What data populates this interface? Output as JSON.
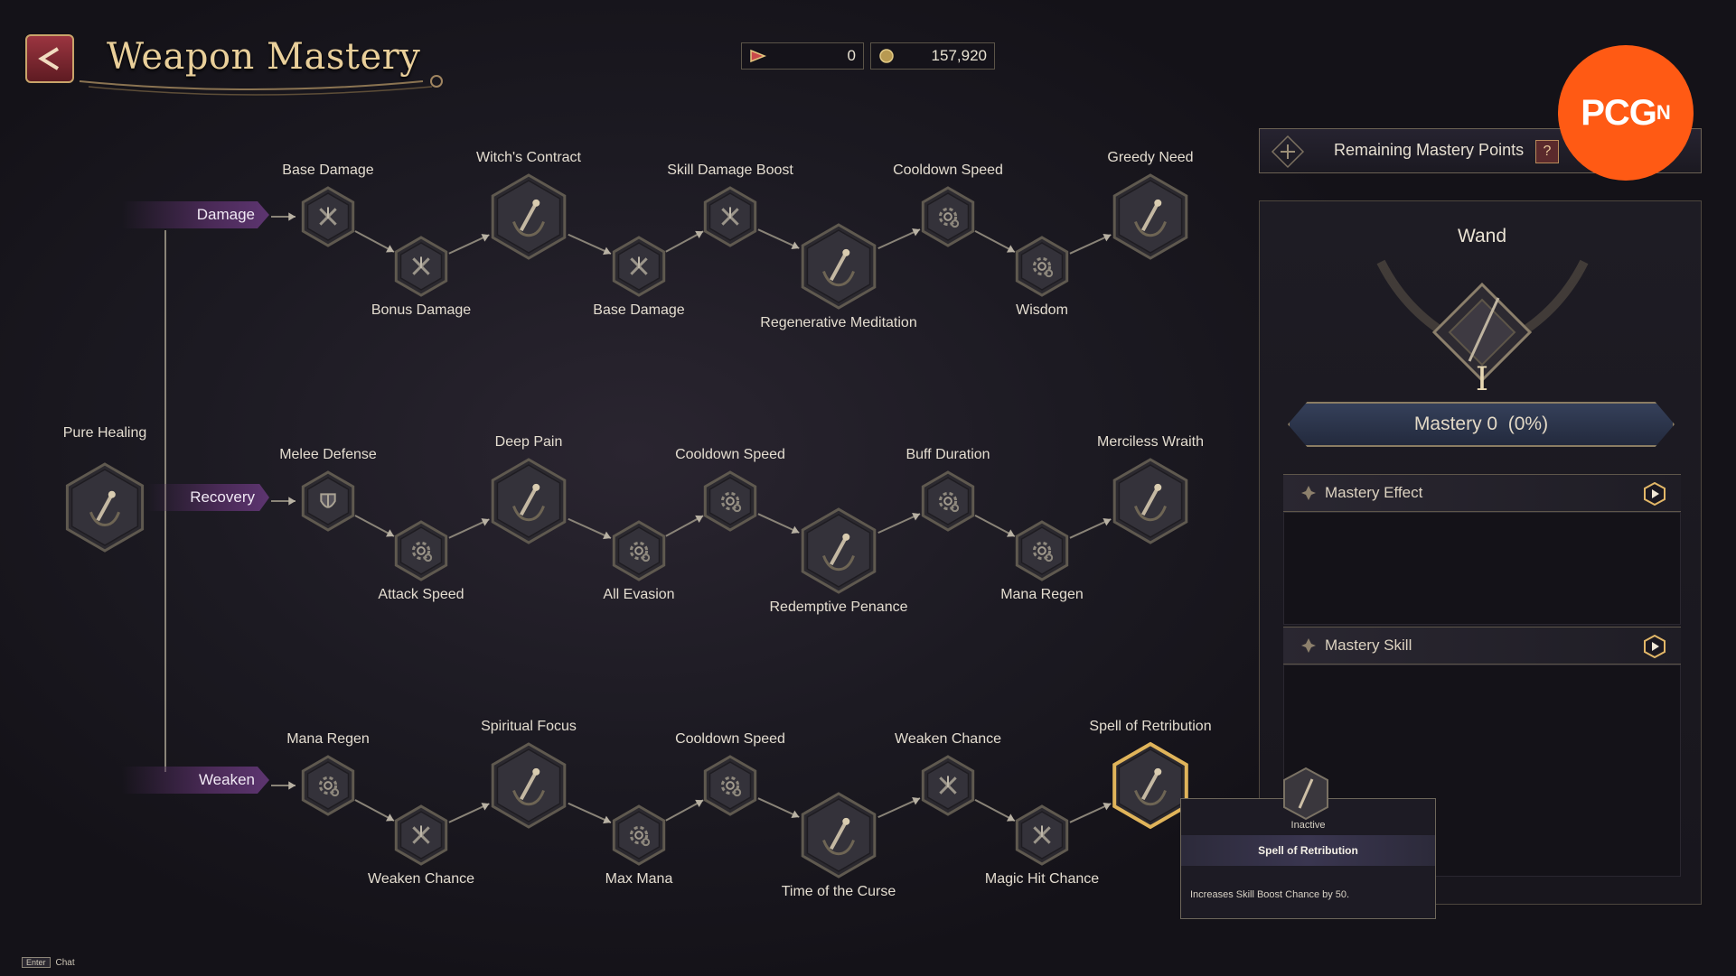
{
  "header": {
    "title": "Weapon Mastery",
    "currency_a": "0",
    "currency_b": "157,920"
  },
  "root_node": {
    "label": "Pure Healing"
  },
  "branches": [
    {
      "name": "Damage",
      "nodes": [
        {
          "label": "Base Damage",
          "type": "small",
          "icon": "crossed-swords-icon"
        },
        {
          "label": "Bonus Damage",
          "type": "small",
          "icon": "crossed-swords-icon"
        },
        {
          "label": "Witch's Contract",
          "type": "large",
          "icon": "wand-icon"
        },
        {
          "label": "Base Damage",
          "type": "small",
          "icon": "crossed-swords-icon"
        },
        {
          "label": "Skill Damage Boost",
          "type": "small",
          "icon": "crossed-swords-icon"
        },
        {
          "label": "Regenerative Meditation",
          "type": "large",
          "icon": "wand-icon"
        },
        {
          "label": "Cooldown Speed",
          "type": "small",
          "icon": "gear-icon"
        },
        {
          "label": "Wisdom",
          "type": "small",
          "icon": "gear-icon"
        },
        {
          "label": "Greedy Need",
          "type": "large",
          "icon": "wand-icon"
        }
      ]
    },
    {
      "name": "Recovery",
      "nodes": [
        {
          "label": "Melee Defense",
          "type": "small",
          "icon": "shield-icon"
        },
        {
          "label": "Attack Speed",
          "type": "small",
          "icon": "gear-icon"
        },
        {
          "label": "Deep Pain",
          "type": "large",
          "icon": "wand-icon"
        },
        {
          "label": "All Evasion",
          "type": "small",
          "icon": "gear-icon"
        },
        {
          "label": "Cooldown Speed",
          "type": "small",
          "icon": "gear-icon"
        },
        {
          "label": "Redemptive Penance",
          "type": "large",
          "icon": "wand-icon"
        },
        {
          "label": "Buff Duration",
          "type": "small",
          "icon": "gear-icon"
        },
        {
          "label": "Mana Regen",
          "type": "small",
          "icon": "gear-icon"
        },
        {
          "label": "Merciless Wraith",
          "type": "large",
          "icon": "wand-icon"
        }
      ]
    },
    {
      "name": "Weaken",
      "nodes": [
        {
          "label": "Mana Regen",
          "type": "small",
          "icon": "gear-icon"
        },
        {
          "label": "Weaken Chance",
          "type": "small",
          "icon": "crossed-swords-icon"
        },
        {
          "label": "Spiritual Focus",
          "type": "large",
          "icon": "wand-icon"
        },
        {
          "label": "Max Mana",
          "type": "small",
          "icon": "gear-icon"
        },
        {
          "label": "Cooldown Speed",
          "type": "small",
          "icon": "gear-icon"
        },
        {
          "label": "Time of the Curse",
          "type": "large",
          "icon": "wand-icon"
        },
        {
          "label": "Weaken Chance",
          "type": "small",
          "icon": "crossed-swords-icon"
        },
        {
          "label": "Magic Hit Chance",
          "type": "small",
          "icon": "crossed-swords-icon"
        },
        {
          "label": "Spell of Retribution",
          "type": "large",
          "icon": "wand-icon",
          "selected": true
        }
      ]
    }
  ],
  "panel": {
    "remaining_label": "Remaining Mastery Points",
    "help_label": "?",
    "weapon_name": "Wand",
    "rank_numeral": "I",
    "mastery_label": "Mastery 0  (0%)",
    "effect_header": "Mastery Effect",
    "skill_header": "Mastery Skill"
  },
  "tooltip": {
    "status": "Inactive",
    "title": "Spell of Retribution",
    "description": "Increases Skill Boost Chance by 50."
  },
  "badge": {
    "text": "PCG",
    "superscript": "N"
  },
  "chat": {
    "key": "Enter",
    "label": "Chat"
  },
  "colors": {
    "accent_gold": "#c9a46a",
    "branch_purple": "#5d3570",
    "badge_orange": "#ff5a14",
    "selected_border": "#e0b45a"
  }
}
